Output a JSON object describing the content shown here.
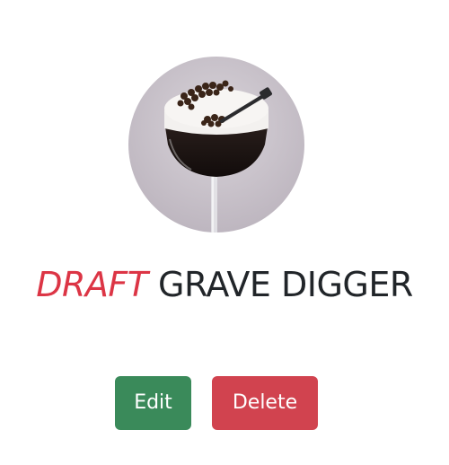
{
  "drink": {
    "status_label": "DRAFT",
    "name": "GRAVE DIGGER"
  },
  "actions": {
    "edit_label": "Edit",
    "delete_label": "Delete"
  },
  "colors": {
    "draft": "#dc3545",
    "edit_button": "#3a8a5a",
    "delete_button": "#d1434f"
  }
}
